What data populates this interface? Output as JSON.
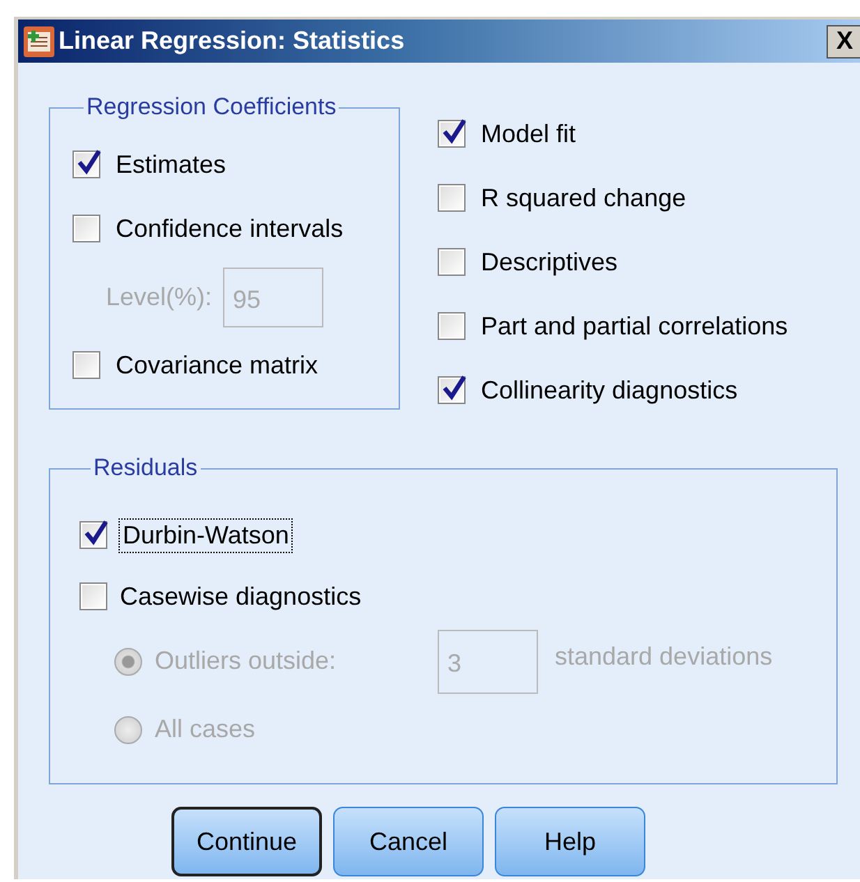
{
  "window": {
    "title": "Linear Regression: Statistics",
    "close": "X"
  },
  "coefficients": {
    "title": "Regression Coefficients",
    "items": [
      {
        "kind": "checkbox",
        "label": "Estimates",
        "checked": true
      },
      {
        "kind": "checkbox",
        "label": "Confidence intervals",
        "checked": false
      },
      {
        "kind": "field",
        "label": "Level(%):",
        "value": "95",
        "disabled": true
      },
      {
        "kind": "checkbox",
        "label": "Covariance matrix",
        "checked": false
      }
    ]
  },
  "options": [
    {
      "label": "Model fit",
      "checked": true
    },
    {
      "label": "R squared change",
      "checked": false
    },
    {
      "label": "Descriptives",
      "checked": false
    },
    {
      "label": "Part and partial correlations",
      "checked": false
    },
    {
      "label": "Collinearity diagnostics",
      "checked": true
    }
  ],
  "residuals": {
    "title": "Residuals",
    "items": [
      {
        "kind": "checkbox",
        "label": "Durbin-Watson",
        "checked": true,
        "focused": true
      },
      {
        "kind": "checkbox",
        "label": "Casewise diagnostics",
        "checked": false,
        "focused": false
      },
      {
        "kind": "radio",
        "label": "Outliers outside:",
        "selected": true,
        "disabled": true,
        "value": "3",
        "suffix": "standard deviations"
      },
      {
        "kind": "radio",
        "label": "All cases",
        "selected": false,
        "disabled": true
      }
    ]
  },
  "buttons": [
    {
      "label": "Continue",
      "default": true
    },
    {
      "label": "Cancel",
      "default": false
    },
    {
      "label": "Help",
      "default": false
    }
  ]
}
